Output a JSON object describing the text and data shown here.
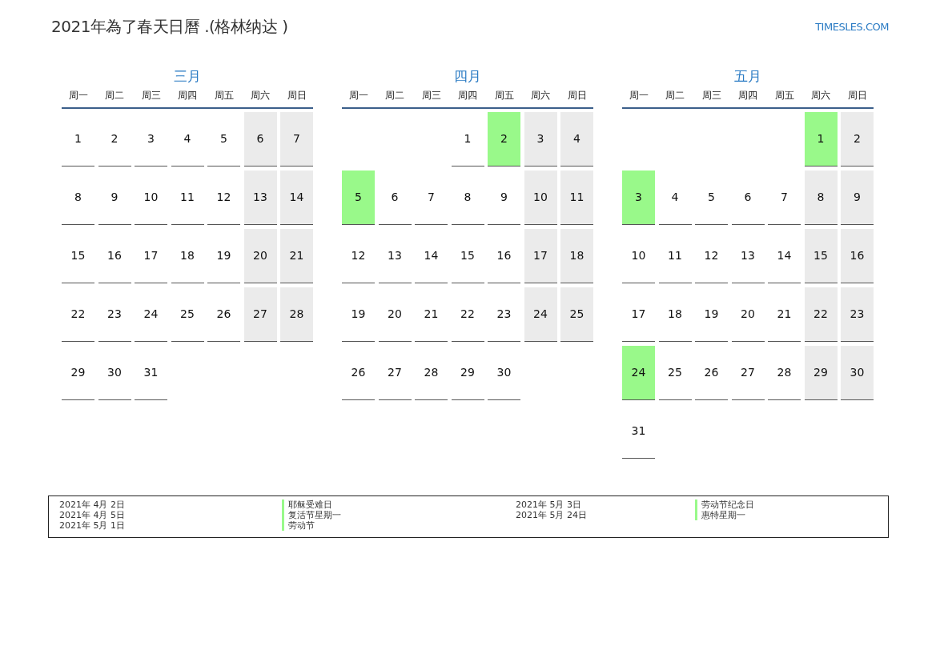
{
  "title": "2021年為了春天日曆 .(格林纳达 )",
  "site": "TIMESLES.COM",
  "months": [
    {
      "name": "三月",
      "weekdays": [
        "周一",
        "周二",
        "周三",
        "周四",
        "周五",
        "周六",
        "周日"
      ],
      "weeks": [
        [
          {
            "kind": "day",
            "day": "1",
            "weekend": false,
            "holiday": false
          },
          {
            "kind": "day",
            "day": "2",
            "weekend": false,
            "holiday": false
          },
          {
            "kind": "day",
            "day": "3",
            "weekend": false,
            "holiday": false
          },
          {
            "kind": "day",
            "day": "4",
            "weekend": false,
            "holiday": false
          },
          {
            "kind": "day",
            "day": "5",
            "weekend": false,
            "holiday": false
          },
          {
            "kind": "day",
            "day": "6",
            "weekend": true,
            "holiday": false
          },
          {
            "kind": "day",
            "day": "7",
            "weekend": true,
            "holiday": false
          }
        ],
        [
          {
            "kind": "day",
            "day": "8",
            "weekend": false,
            "holiday": false
          },
          {
            "kind": "day",
            "day": "9",
            "weekend": false,
            "holiday": false
          },
          {
            "kind": "day",
            "day": "10",
            "weekend": false,
            "holiday": false
          },
          {
            "kind": "day",
            "day": "11",
            "weekend": false,
            "holiday": false
          },
          {
            "kind": "day",
            "day": "12",
            "weekend": false,
            "holiday": false
          },
          {
            "kind": "day",
            "day": "13",
            "weekend": true,
            "holiday": false
          },
          {
            "kind": "day",
            "day": "14",
            "weekend": true,
            "holiday": false
          }
        ],
        [
          {
            "kind": "day",
            "day": "15",
            "weekend": false,
            "holiday": false
          },
          {
            "kind": "day",
            "day": "16",
            "weekend": false,
            "holiday": false
          },
          {
            "kind": "day",
            "day": "17",
            "weekend": false,
            "holiday": false
          },
          {
            "kind": "day",
            "day": "18",
            "weekend": false,
            "holiday": false
          },
          {
            "kind": "day",
            "day": "19",
            "weekend": false,
            "holiday": false
          },
          {
            "kind": "day",
            "day": "20",
            "weekend": true,
            "holiday": false
          },
          {
            "kind": "day",
            "day": "21",
            "weekend": true,
            "holiday": false
          }
        ],
        [
          {
            "kind": "day",
            "day": "22",
            "weekend": false,
            "holiday": false
          },
          {
            "kind": "day",
            "day": "23",
            "weekend": false,
            "holiday": false
          },
          {
            "kind": "day",
            "day": "24",
            "weekend": false,
            "holiday": false
          },
          {
            "kind": "day",
            "day": "25",
            "weekend": false,
            "holiday": false
          },
          {
            "kind": "day",
            "day": "26",
            "weekend": false,
            "holiday": false
          },
          {
            "kind": "day",
            "day": "27",
            "weekend": true,
            "holiday": false
          },
          {
            "kind": "day",
            "day": "28",
            "weekend": true,
            "holiday": false
          }
        ],
        [
          {
            "kind": "day",
            "day": "29",
            "weekend": false,
            "holiday": false
          },
          {
            "kind": "day",
            "day": "30",
            "weekend": false,
            "holiday": false
          },
          {
            "kind": "day",
            "day": "31",
            "weekend": false,
            "holiday": false
          }
        ]
      ]
    },
    {
      "name": "四月",
      "weekdays": [
        "周一",
        "周二",
        "周三",
        "周四",
        "周五",
        "周六",
        "周日"
      ],
      "weeks": [
        [
          {
            "kind": "empty"
          },
          {
            "kind": "empty"
          },
          {
            "kind": "empty"
          },
          {
            "kind": "day",
            "day": "1",
            "weekend": false,
            "holiday": false
          },
          {
            "kind": "day",
            "day": "2",
            "weekend": false,
            "holiday": true
          },
          {
            "kind": "day",
            "day": "3",
            "weekend": true,
            "holiday": false
          },
          {
            "kind": "day",
            "day": "4",
            "weekend": true,
            "holiday": false
          }
        ],
        [
          {
            "kind": "day",
            "day": "5",
            "weekend": false,
            "holiday": true
          },
          {
            "kind": "day",
            "day": "6",
            "weekend": false,
            "holiday": false
          },
          {
            "kind": "day",
            "day": "7",
            "weekend": false,
            "holiday": false
          },
          {
            "kind": "day",
            "day": "8",
            "weekend": false,
            "holiday": false
          },
          {
            "kind": "day",
            "day": "9",
            "weekend": false,
            "holiday": false
          },
          {
            "kind": "day",
            "day": "10",
            "weekend": true,
            "holiday": false
          },
          {
            "kind": "day",
            "day": "11",
            "weekend": true,
            "holiday": false
          }
        ],
        [
          {
            "kind": "day",
            "day": "12",
            "weekend": false,
            "holiday": false
          },
          {
            "kind": "day",
            "day": "13",
            "weekend": false,
            "holiday": false
          },
          {
            "kind": "day",
            "day": "14",
            "weekend": false,
            "holiday": false
          },
          {
            "kind": "day",
            "day": "15",
            "weekend": false,
            "holiday": false
          },
          {
            "kind": "day",
            "day": "16",
            "weekend": false,
            "holiday": false
          },
          {
            "kind": "day",
            "day": "17",
            "weekend": true,
            "holiday": false
          },
          {
            "kind": "day",
            "day": "18",
            "weekend": true,
            "holiday": false
          }
        ],
        [
          {
            "kind": "day",
            "day": "19",
            "weekend": false,
            "holiday": false
          },
          {
            "kind": "day",
            "day": "20",
            "weekend": false,
            "holiday": false
          },
          {
            "kind": "day",
            "day": "21",
            "weekend": false,
            "holiday": false
          },
          {
            "kind": "day",
            "day": "22",
            "weekend": false,
            "holiday": false
          },
          {
            "kind": "day",
            "day": "23",
            "weekend": false,
            "holiday": false
          },
          {
            "kind": "day",
            "day": "24",
            "weekend": true,
            "holiday": false
          },
          {
            "kind": "day",
            "day": "25",
            "weekend": true,
            "holiday": false
          }
        ],
        [
          {
            "kind": "day",
            "day": "26",
            "weekend": false,
            "holiday": false
          },
          {
            "kind": "day",
            "day": "27",
            "weekend": false,
            "holiday": false
          },
          {
            "kind": "day",
            "day": "28",
            "weekend": false,
            "holiday": false
          },
          {
            "kind": "day",
            "day": "29",
            "weekend": false,
            "holiday": false
          },
          {
            "kind": "day",
            "day": "30",
            "weekend": false,
            "holiday": false
          }
        ]
      ]
    },
    {
      "name": "五月",
      "weekdays": [
        "周一",
        "周二",
        "周三",
        "周四",
        "周五",
        "周六",
        "周日"
      ],
      "weeks": [
        [
          {
            "kind": "empty"
          },
          {
            "kind": "empty"
          },
          {
            "kind": "empty"
          },
          {
            "kind": "empty"
          },
          {
            "kind": "empty"
          },
          {
            "kind": "day",
            "day": "1",
            "weekend": true,
            "holiday": true
          },
          {
            "kind": "day",
            "day": "2",
            "weekend": true,
            "holiday": false
          }
        ],
        [
          {
            "kind": "day",
            "day": "3",
            "weekend": false,
            "holiday": true
          },
          {
            "kind": "day",
            "day": "4",
            "weekend": false,
            "holiday": false
          },
          {
            "kind": "day",
            "day": "5",
            "weekend": false,
            "holiday": false
          },
          {
            "kind": "day",
            "day": "6",
            "weekend": false,
            "holiday": false
          },
          {
            "kind": "day",
            "day": "7",
            "weekend": false,
            "holiday": false
          },
          {
            "kind": "day",
            "day": "8",
            "weekend": true,
            "holiday": false
          },
          {
            "kind": "day",
            "day": "9",
            "weekend": true,
            "holiday": false
          }
        ],
        [
          {
            "kind": "day",
            "day": "10",
            "weekend": false,
            "holiday": false
          },
          {
            "kind": "day",
            "day": "11",
            "weekend": false,
            "holiday": false
          },
          {
            "kind": "day",
            "day": "12",
            "weekend": false,
            "holiday": false
          },
          {
            "kind": "day",
            "day": "13",
            "weekend": false,
            "holiday": false
          },
          {
            "kind": "day",
            "day": "14",
            "weekend": false,
            "holiday": false
          },
          {
            "kind": "day",
            "day": "15",
            "weekend": true,
            "holiday": false
          },
          {
            "kind": "day",
            "day": "16",
            "weekend": true,
            "holiday": false
          }
        ],
        [
          {
            "kind": "day",
            "day": "17",
            "weekend": false,
            "holiday": false
          },
          {
            "kind": "day",
            "day": "18",
            "weekend": false,
            "holiday": false
          },
          {
            "kind": "day",
            "day": "19",
            "weekend": false,
            "holiday": false
          },
          {
            "kind": "day",
            "day": "20",
            "weekend": false,
            "holiday": false
          },
          {
            "kind": "day",
            "day": "21",
            "weekend": false,
            "holiday": false
          },
          {
            "kind": "day",
            "day": "22",
            "weekend": true,
            "holiday": false
          },
          {
            "kind": "day",
            "day": "23",
            "weekend": true,
            "holiday": false
          }
        ],
        [
          {
            "kind": "day",
            "day": "24",
            "weekend": false,
            "holiday": true
          },
          {
            "kind": "day",
            "day": "25",
            "weekend": false,
            "holiday": false
          },
          {
            "kind": "day",
            "day": "26",
            "weekend": false,
            "holiday": false
          },
          {
            "kind": "day",
            "day": "27",
            "weekend": false,
            "holiday": false
          },
          {
            "kind": "day",
            "day": "28",
            "weekend": false,
            "holiday": false
          },
          {
            "kind": "day",
            "day": "29",
            "weekend": true,
            "holiday": false
          },
          {
            "kind": "day",
            "day": "30",
            "weekend": true,
            "holiday": false
          }
        ],
        [
          {
            "kind": "day",
            "day": "31",
            "weekend": false,
            "holiday": false
          }
        ]
      ]
    }
  ],
  "holidays": [
    {
      "date": "2021年 4月 2日",
      "name": "耶稣受难日"
    },
    {
      "date": "2021年 4月 5日",
      "name": "复活节星期一"
    },
    {
      "date": "2021年 5月 1日",
      "name": "劳动节"
    },
    {
      "date": "2021年 5月 3日",
      "name": "劳动节纪念日"
    },
    {
      "date": "2021年 5月 24日",
      "name": "惠特星期一"
    }
  ]
}
